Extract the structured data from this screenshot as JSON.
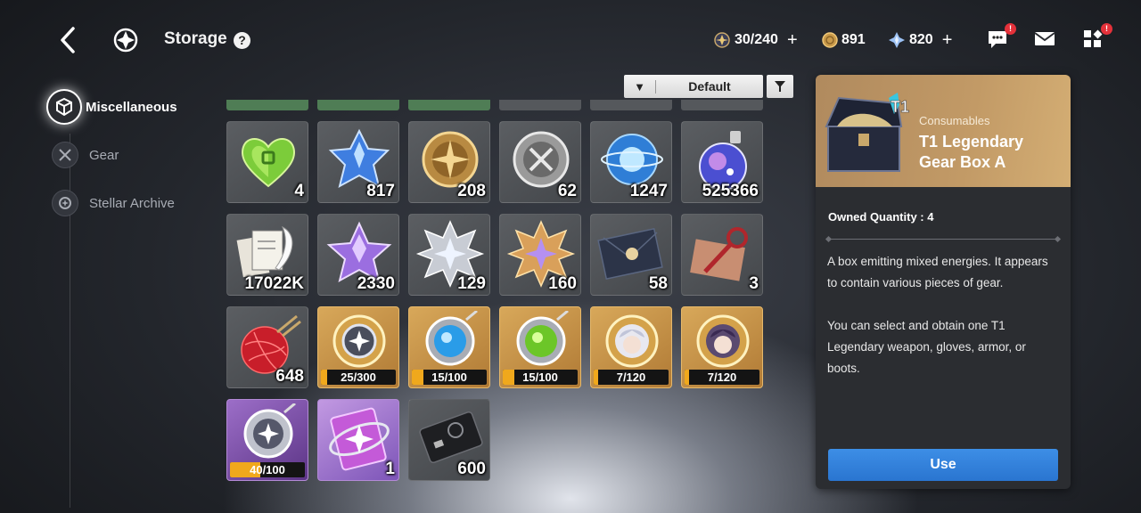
{
  "header": {
    "title": "Storage",
    "help_label": "?",
    "stamina": "30/240",
    "gold": "891",
    "crystal": "820",
    "plus": "+",
    "chat_badge": "!",
    "menu_badge": "!"
  },
  "sidebar": {
    "items": [
      {
        "label": "Miscellaneous"
      },
      {
        "label": "Gear"
      },
      {
        "label": "Stellar Archive"
      }
    ]
  },
  "sort": {
    "value": "Default",
    "arrow": "▼"
  },
  "items": [
    {
      "name": "green-heart-gem",
      "qty": "4"
    },
    {
      "name": "blue-star-crystal",
      "qty": "817"
    },
    {
      "name": "gold-compass-coin",
      "qty": "208"
    },
    {
      "name": "silver-axe-coin",
      "qty": "62"
    },
    {
      "name": "blue-energy-orb",
      "qty": "1247"
    },
    {
      "name": "cosmic-potion-bottle",
      "qty": "525366"
    },
    {
      "name": "letters-quill",
      "qty": "17022K"
    },
    {
      "name": "purple-star-crystal",
      "qty": "2330"
    },
    {
      "name": "silver-star-emblem",
      "qty": "129"
    },
    {
      "name": "gold-star-emblem",
      "qty": "160"
    },
    {
      "name": "sealed-envelope",
      "qty": "58"
    },
    {
      "name": "red-key-letter",
      "qty": "3"
    },
    {
      "name": "red-yarn-ball",
      "qty": "648"
    },
    {
      "name": "star-orb-fragment",
      "progress": "25/300",
      "fraction": 0.0833
    },
    {
      "name": "blue-orb-fragment",
      "progress": "15/100",
      "fraction": 0.15
    },
    {
      "name": "green-orb-fragment",
      "progress": "15/100",
      "fraction": 0.15
    },
    {
      "name": "silver-hair-character-fragment",
      "progress": "7/120",
      "fraction": 0.0583
    },
    {
      "name": "purple-hair-character-fragment",
      "progress": "7/120",
      "fraction": 0.0583
    },
    {
      "name": "purple-star-fragment",
      "progress": "40/100",
      "fraction": 0.4
    },
    {
      "name": "purple-star-card",
      "qty": "1"
    },
    {
      "name": "black-card",
      "qty": "600"
    }
  ],
  "detail": {
    "tier_label": "T1",
    "category": "Consumables",
    "name": "T1 Legendary Gear Box A",
    "owned": "Owned Quantity : 4",
    "desc1": "A box emitting mixed energies. It appears to contain various pieces of gear.",
    "desc2": "You can select and obtain one T1 Legendary weapon, gloves, armor, or boots.",
    "use_label": "Use"
  },
  "colors": {
    "accent_blue": "#2a75d0",
    "progress_orange": "#f0a81c",
    "badge_red": "#e4313a"
  }
}
